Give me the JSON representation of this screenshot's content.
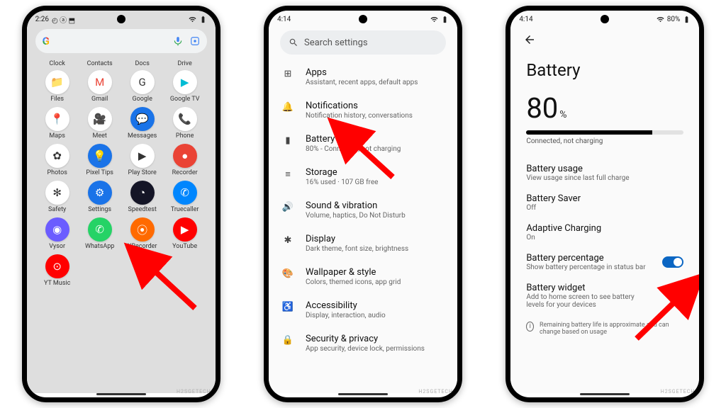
{
  "phone1": {
    "status": {
      "time": "2:26",
      "icons": "◴ ⓐ ⬒"
    },
    "row0_labels": [
      "Clock",
      "Contacts",
      "Docs",
      "Drive"
    ],
    "apps": [
      {
        "label": "Files",
        "glyph": "📁",
        "bg": "#fff"
      },
      {
        "label": "Gmail",
        "glyph": "M",
        "bg": "#fff",
        "color": "#ea4335"
      },
      {
        "label": "Google",
        "glyph": "G",
        "bg": "#fff"
      },
      {
        "label": "Google TV",
        "glyph": "▶",
        "bg": "#fff",
        "color": "#00bcd4"
      },
      {
        "label": "Maps",
        "glyph": "📍",
        "bg": "#fff"
      },
      {
        "label": "Meet",
        "glyph": "🎥",
        "bg": "#fff",
        "color": "#1a73e8"
      },
      {
        "label": "Messages",
        "glyph": "💬",
        "bg": "#1a73e8",
        "color": "#fff"
      },
      {
        "label": "Phone",
        "glyph": "📞",
        "bg": "#fff",
        "color": "#1a73e8"
      },
      {
        "label": "Photos",
        "glyph": "✿",
        "bg": "#fff"
      },
      {
        "label": "Pixel Tips",
        "glyph": "💡",
        "bg": "#1a73e8",
        "color": "#fff"
      },
      {
        "label": "Play Store",
        "glyph": "▶",
        "bg": "#fff"
      },
      {
        "label": "Recorder",
        "glyph": "●",
        "bg": "#ea4335",
        "color": "#fff"
      },
      {
        "label": "Safety",
        "glyph": "✻",
        "bg": "#fff"
      },
      {
        "label": "Settings",
        "glyph": "⚙",
        "bg": "#1a73e8",
        "color": "#fff"
      },
      {
        "label": "Speedtest",
        "glyph": "◔",
        "bg": "#141526",
        "color": "#fff"
      },
      {
        "label": "Truecaller",
        "glyph": "✆",
        "bg": "#0086fe",
        "color": "#fff"
      },
      {
        "label": "Vysor",
        "glyph": "◉",
        "bg": "#6b5cff",
        "color": "#fff"
      },
      {
        "label": "WhatsApp",
        "glyph": "✆",
        "bg": "#25d366",
        "color": "#fff"
      },
      {
        "label": "XRecorder",
        "glyph": "⦿",
        "bg": "#ff6a00",
        "color": "#fff"
      },
      {
        "label": "YouTube",
        "glyph": "▶",
        "bg": "#ff0000",
        "color": "#fff"
      },
      {
        "label": "YT Music",
        "glyph": "⊙",
        "bg": "#ff0000",
        "color": "#fff"
      }
    ]
  },
  "phone2": {
    "status": {
      "time": "4:14"
    },
    "search_placeholder": "Search settings",
    "items": [
      {
        "icon": "⊞",
        "title": "Apps",
        "sub": "Assistant, recent apps, default apps"
      },
      {
        "icon": "🔔",
        "title": "Notifications",
        "sub": "Notification history, conversations"
      },
      {
        "icon": "▮",
        "title": "Battery",
        "sub": "80% - Connected, not charging"
      },
      {
        "icon": "≡",
        "title": "Storage",
        "sub": "16% used · 107 GB free"
      },
      {
        "icon": "🔊",
        "title": "Sound & vibration",
        "sub": "Volume, haptics, Do Not Disturb"
      },
      {
        "icon": "✱",
        "title": "Display",
        "sub": "Dark theme, font size, brightness"
      },
      {
        "icon": "🎨",
        "title": "Wallpaper & style",
        "sub": "Colors, themed icons, app grid"
      },
      {
        "icon": "♿",
        "title": "Accessibility",
        "sub": "Display, interaction, audio"
      },
      {
        "icon": "🔒",
        "title": "Security & privacy",
        "sub": "App security, device lock, permissions"
      }
    ]
  },
  "phone3": {
    "status": {
      "time": "4:14",
      "battery_label": "80%"
    },
    "title": "Battery",
    "percent": "80",
    "percent_suffix": "%",
    "progress_caption": "Connected, not charging",
    "rows": [
      {
        "title": "Battery usage",
        "sub": "View usage since last full charge"
      },
      {
        "title": "Battery Saver",
        "sub": "Off"
      },
      {
        "title": "Adaptive Charging",
        "sub": "On"
      },
      {
        "title": "Battery percentage",
        "sub": "Show battery percentage in status bar",
        "toggle": true
      },
      {
        "title": "Battery widget",
        "sub": "Add to home screen to see battery levels for your devices"
      }
    ],
    "info_text": "Remaining battery life is approximate and can change based on usage"
  },
  "watermark": "H2SGETECH"
}
